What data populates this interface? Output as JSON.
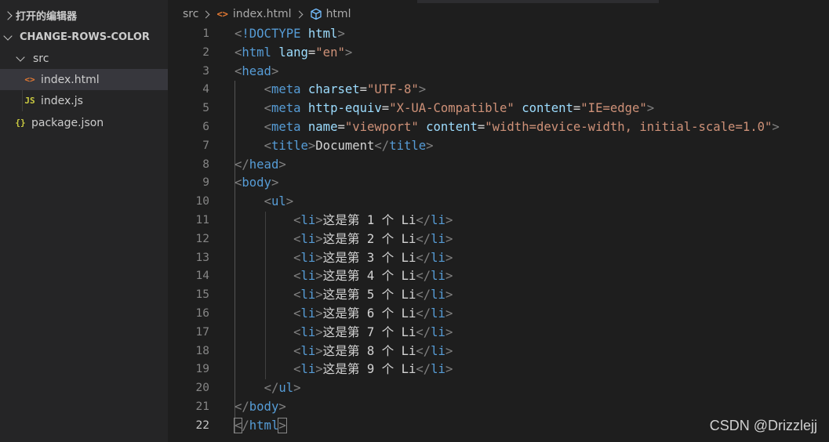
{
  "sidebar": {
    "open_editors": "打开的编辑器",
    "project": "CHANGE-ROWS-COLOR",
    "folder": "src",
    "files": [
      {
        "name": "index.html",
        "icon": "html-file-icon",
        "selected": true
      },
      {
        "name": "index.js",
        "icon": "js-file-icon"
      }
    ],
    "root_file": {
      "name": "package.json",
      "icon": "json-file-icon"
    }
  },
  "breadcrumb": {
    "folder": "src",
    "file": "index.html",
    "symbol": "html"
  },
  "editor": {
    "active_line": 22,
    "lines": [
      {
        "n": "1"
      },
      {
        "n": "2"
      },
      {
        "n": "3"
      },
      {
        "n": "4"
      },
      {
        "n": "5"
      },
      {
        "n": "6"
      },
      {
        "n": "7"
      },
      {
        "n": "8"
      },
      {
        "n": "9"
      },
      {
        "n": "10"
      },
      {
        "n": "11"
      },
      {
        "n": "12"
      },
      {
        "n": "13"
      },
      {
        "n": "14"
      },
      {
        "n": "15"
      },
      {
        "n": "16"
      },
      {
        "n": "17"
      },
      {
        "n": "18"
      },
      {
        "n": "19"
      },
      {
        "n": "20"
      },
      {
        "n": "21"
      },
      {
        "n": "22"
      }
    ],
    "code": {
      "l1": {
        "doctype": "!DOCTYPE",
        "html": "html"
      },
      "l2": {
        "tag": "html",
        "attr": "lang",
        "val": "\"en\""
      },
      "l3": {
        "tag": "head"
      },
      "l4": {
        "tag": "meta",
        "attr": "charset",
        "val": "\"UTF-8\""
      },
      "l5": {
        "tag": "meta",
        "attr1": "http-equiv",
        "val1": "\"X-UA-Compatible\"",
        "attr2": "content",
        "val2": "\"IE=edge\""
      },
      "l6": {
        "tag": "meta",
        "attr1": "name",
        "val1": "\"viewport\"",
        "attr2": "content",
        "val2": "\"width=device-width, initial-scale=1.0\""
      },
      "l7": {
        "tag": "title",
        "text": "Document"
      },
      "l8": {
        "tag": "head"
      },
      "l9": {
        "tag": "body"
      },
      "l10": {
        "tag": "ul"
      },
      "li_items": [
        "这是第 1 个 Li",
        "这是第 2 个 Li",
        "这是第 3 个 Li",
        "这是第 4 个 Li",
        "这是第 5 个 Li",
        "这是第 6 个 Li",
        "这是第 7 个 Li",
        "这是第 8 个 Li",
        "这是第 9 个 Li"
      ],
      "li_tag": "li",
      "l20": {
        "tag": "ul"
      },
      "l21": {
        "tag": "body"
      },
      "l22": {
        "tag": "html"
      }
    }
  },
  "watermark": "CSDN @Drizzlejj"
}
